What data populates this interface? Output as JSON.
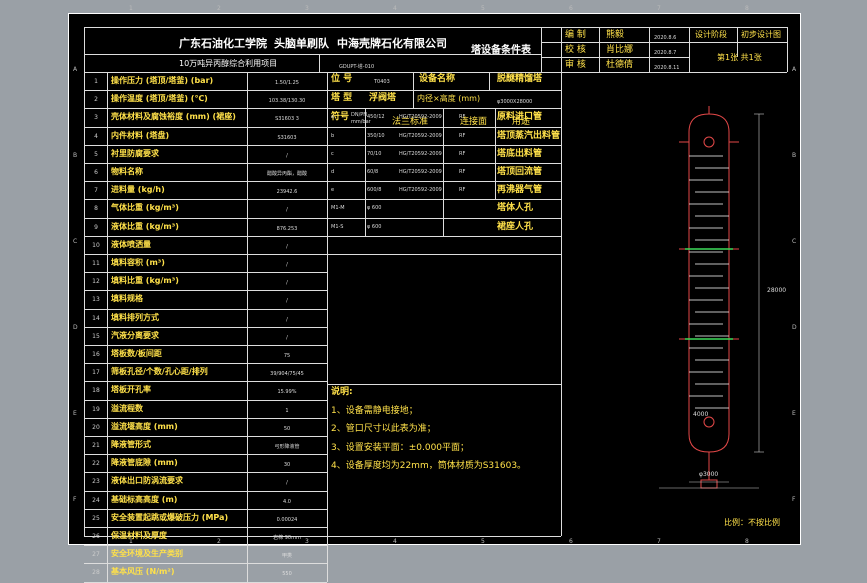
{
  "title_block": {
    "org1": "广东石油化工学院",
    "org2": "头脑单刷队",
    "org3": "中海壳牌石化有限公司",
    "project": "10万吨异丙醇综合利用项目",
    "doc_title": "塔设备条件表",
    "drawing_no": "GDUPT-塔-010",
    "row1_label": "编  制",
    "row1_name": "熊毅",
    "row2_label": "校  核",
    "row2_name": "肖比娜",
    "row3_label": "审  核",
    "row3_name": "杜德倩",
    "date1": "2020.8.6",
    "date2": "2020.8.7",
    "date3": "2020.8.11",
    "stage_label": "设计阶段",
    "stage_value": "初步设计图",
    "sheet_info": "第1张  共1张"
  },
  "equip": {
    "pos_label": "位  号",
    "pos_value": "T0403",
    "name_label": "设备名称",
    "name_value": "脱醚精馏塔",
    "type_label": "塔  型",
    "type_value": "浮阀塔",
    "dia_label": "内径×高度 (mm)",
    "dia_value": "φ3000X28000"
  },
  "nozzle_header": {
    "symbol": "符号",
    "nominal": "DN/PN mm/bar",
    "standard": "法兰标准",
    "face": "连接面",
    "use": "用途"
  },
  "nozzles": [
    {
      "sym": "a",
      "dn": "450/12",
      "std": "HG/T20592-2009",
      "face": "RF",
      "use": "原料进口管"
    },
    {
      "sym": "b",
      "dn": "350/10",
      "std": "HG/T20592-2009",
      "face": "RF",
      "use": "塔顶蒸汽出料管"
    },
    {
      "sym": "c",
      "dn": "70/10",
      "std": "HG/T20592-2009",
      "face": "RF",
      "use": "塔底出料管"
    },
    {
      "sym": "d",
      "dn": "60/8",
      "std": "HG/T20592-2009",
      "face": "RF",
      "use": "塔顶回流管"
    },
    {
      "sym": "e",
      "dn": "600/8",
      "std": "HG/T20592-2009",
      "face": "RF",
      "use": "再沸器气管"
    },
    {
      "sym": "M1-M",
      "dn": "φ 600",
      "std": "",
      "face": "",
      "use": "塔体人孔"
    },
    {
      "sym": "M1-S",
      "dn": "φ 600",
      "std": "",
      "face": "",
      "use": "裙座人孔"
    }
  ],
  "params": [
    {
      "no": "1",
      "name": "操作压力 (塔顶/塔釜) (bar)",
      "value": "1.50/1.25"
    },
    {
      "no": "2",
      "name": "操作温度 (塔顶/塔釜) (℃)",
      "value": "103.38/130.30"
    },
    {
      "no": "3",
      "name": "壳体材料及腐蚀裕度 (mm) (裙座)",
      "value": "S31603 3"
    },
    {
      "no": "4",
      "name": "内件材料 (塔盘)",
      "value": "S31603"
    },
    {
      "no": "5",
      "name": "衬里防腐要求",
      "value": "/"
    },
    {
      "no": "6",
      "name": "物料名称",
      "value": "醋酸异丙酯，醋酸"
    },
    {
      "no": "7",
      "name": "进料量 (kg/h)",
      "value": "23942.6"
    },
    {
      "no": "8",
      "name": "气体比重 (kg/m³)",
      "value": "/"
    },
    {
      "no": "9",
      "name": "液体比重 (kg/m³)",
      "value": "876.253"
    },
    {
      "no": "10",
      "name": "液体喷洒量",
      "value": "/"
    },
    {
      "no": "11",
      "name": "填料容积 (m³)",
      "value": "/"
    },
    {
      "no": "12",
      "name": "填料比重 (kg/m³)",
      "value": "/"
    },
    {
      "no": "13",
      "name": "填料规格",
      "value": "/"
    },
    {
      "no": "14",
      "name": "填料排列方式",
      "value": "/"
    },
    {
      "no": "15",
      "name": "汽液分离要求",
      "value": "/"
    },
    {
      "no": "16",
      "name": "塔板数/板间距",
      "value": "75"
    },
    {
      "no": "17",
      "name": "筛板孔径/个数/孔心距/排列",
      "value": "39/904/75/45"
    },
    {
      "no": "18",
      "name": "塔板开孔率",
      "value": "15.99%"
    },
    {
      "no": "19",
      "name": "溢流程数",
      "value": "1"
    },
    {
      "no": "20",
      "name": "溢流堰高度 (mm)",
      "value": "50"
    },
    {
      "no": "21",
      "name": "降液管形式",
      "value": "弓形降液管"
    },
    {
      "no": "22",
      "name": "降液管底隙 (mm)",
      "value": "30"
    },
    {
      "no": "23",
      "name": "液体出口防涡流要求",
      "value": "/"
    },
    {
      "no": "24",
      "name": "基础标高高度 (m)",
      "value": "4.0"
    },
    {
      "no": "25",
      "name": "安全装置起跳或爆破压力 (MPa)",
      "value": "0.00024"
    },
    {
      "no": "26",
      "name": "保温材料及厚度",
      "value": "岩棉 90mm"
    },
    {
      "no": "27",
      "name": "安全环境及生产类别",
      "value": "甲类"
    },
    {
      "no": "28",
      "name": "基本风压 (N/m²)",
      "value": "550"
    }
  ],
  "notes": {
    "title": "说明:",
    "items": [
      "1、设备需静电接地；",
      "2、管口尺寸以此表为准；",
      "3、设置安装平面：±0.000平面；",
      "4、设备厚度均为22mm，筒体材质为S31603。"
    ]
  },
  "drawing": {
    "dims": [
      "28000",
      "4000",
      "φ3000"
    ],
    "scale": "比例：不按比例"
  },
  "zones": {
    "cols": [
      "1",
      "2",
      "3",
      "4",
      "5",
      "6",
      "7",
      "8"
    ],
    "rows": [
      "A",
      "B",
      "C",
      "D",
      "E",
      "F"
    ]
  }
}
